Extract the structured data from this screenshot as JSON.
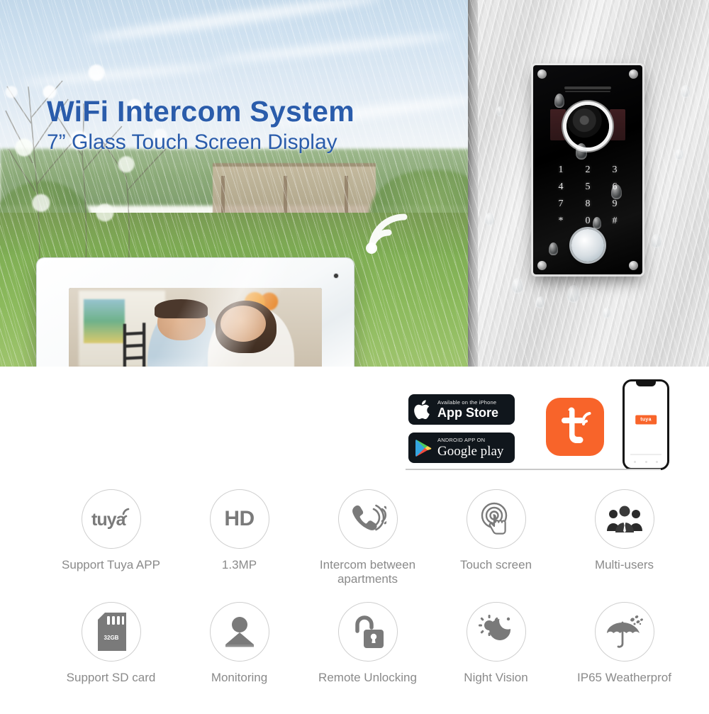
{
  "hero": {
    "headline": "WiFi Intercom System",
    "subheadline": "7” Glass Touch Screen Display",
    "headline_color": "#2a5cab",
    "wifi_icon": "wifi-signal-icon",
    "background_scene": "rainy-garden-with-lawn-and-blossom-tree",
    "wall_scene": "gray-concrete-wall-with-water-droplets"
  },
  "door_station": {
    "name": "outdoor-door-station",
    "body_color": "#000000",
    "keypad": [
      "1",
      "2",
      "3",
      "4",
      "5",
      "6",
      "7",
      "8",
      "9",
      "*",
      "0",
      "#"
    ],
    "components": [
      "speaker-grille",
      "camera-lens",
      "ir-led-panel",
      "keypad",
      "call-button"
    ]
  },
  "monitor": {
    "name": "indoor-monitor",
    "bezel_color": "#ffffff",
    "screen_content": "couple-on-couch-looking-at-smartphone"
  },
  "app_panel": {
    "appstore": {
      "small": "Available on the iPhone",
      "big": "App Store",
      "icon": "apple-logo-icon"
    },
    "googleplay": {
      "small": "ANDROID APP ON",
      "big": "Google play",
      "icon": "google-play-triangle-icon"
    },
    "tuya_tile": {
      "label": "tuya-app-icon",
      "color": "#f8642a"
    },
    "phone_mockup": {
      "label": "phone-splash-screen",
      "logo_text": "tuya"
    }
  },
  "features": {
    "row1": [
      {
        "icon": "tuya-logo-icon",
        "glyph": "tuya",
        "label": "Support Tuya APP"
      },
      {
        "icon": "hd-badge-icon",
        "glyph": "HD",
        "label": "1.3MP"
      },
      {
        "icon": "phone-call-ringing-icon",
        "glyph": "",
        "label": "Intercom between apartments"
      },
      {
        "icon": "touch-finger-icon",
        "glyph": "",
        "label": "Touch screen"
      },
      {
        "icon": "multi-users-icon",
        "glyph": "",
        "label": "Multi-users"
      }
    ],
    "row2": [
      {
        "icon": "sd-card-icon",
        "glyph": "32GB",
        "label": "Support  SD card"
      },
      {
        "icon": "person-monitoring-icon",
        "glyph": "",
        "label": "Monitoring"
      },
      {
        "icon": "open-padlock-icon",
        "glyph": "",
        "label": "Remote Unlocking"
      },
      {
        "icon": "sun-moon-night-vision-icon",
        "glyph": "",
        "label": "Night Vision"
      },
      {
        "icon": "umbrella-rain-icon",
        "glyph": "",
        "label": "IP65 Weatherprof"
      }
    ]
  },
  "colors": {
    "accent_blue": "#2a5cab",
    "tuya_orange": "#f8642a",
    "label_gray": "#8a8a8a",
    "circle_border": "#cfcfcf"
  }
}
